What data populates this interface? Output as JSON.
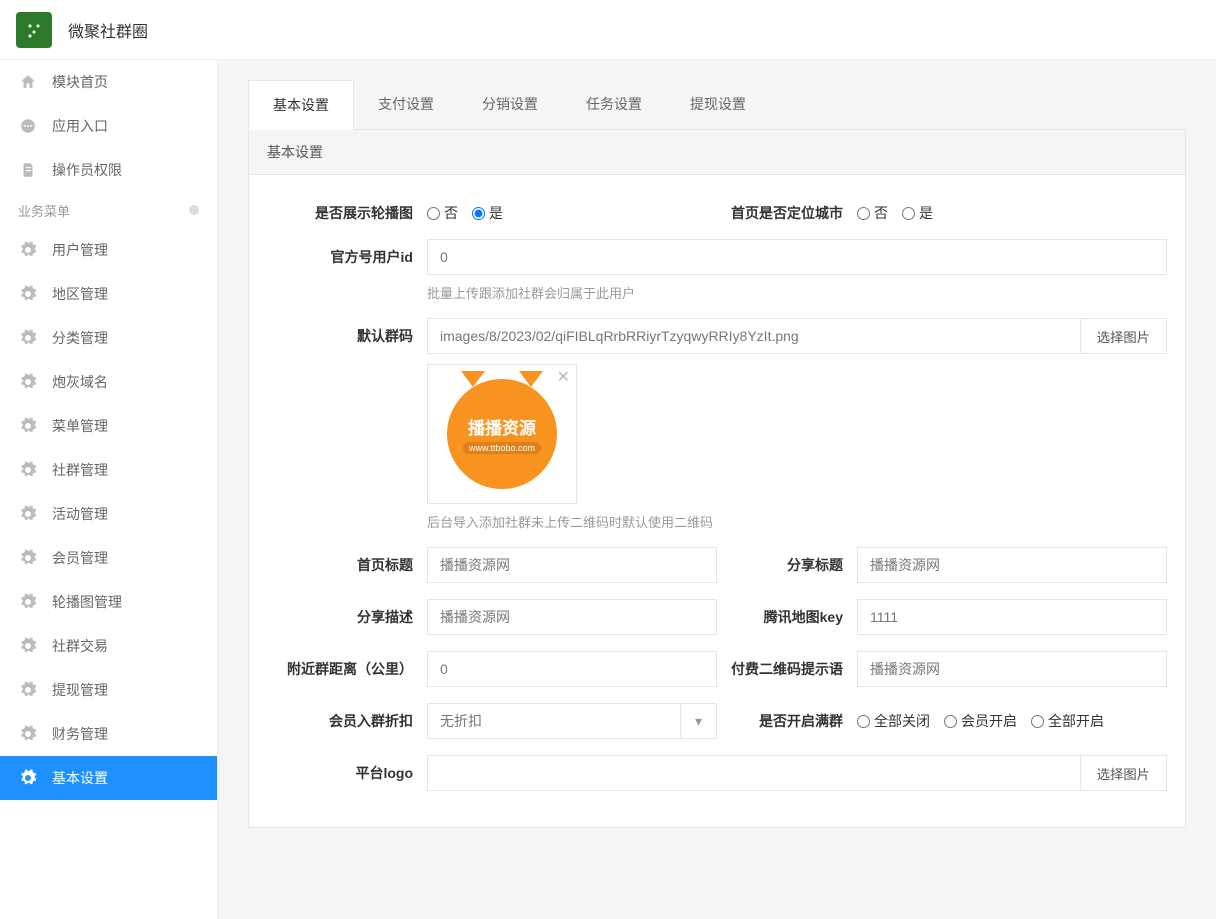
{
  "header": {
    "app_title": "微聚社群圈"
  },
  "sidebar": {
    "top_items": [
      {
        "label": "模块首页",
        "icon": "home"
      },
      {
        "label": "应用入口",
        "icon": "chat"
      },
      {
        "label": "操作员权限",
        "icon": "doc"
      }
    ],
    "section_label": "业务菜单",
    "biz_items": [
      {
        "label": "用户管理"
      },
      {
        "label": "地区管理"
      },
      {
        "label": "分类管理"
      },
      {
        "label": "炮灰域名"
      },
      {
        "label": "菜单管理"
      },
      {
        "label": "社群管理"
      },
      {
        "label": "活动管理"
      },
      {
        "label": "会员管理"
      },
      {
        "label": "轮播图管理"
      },
      {
        "label": "社群交易"
      },
      {
        "label": "提现管理"
      },
      {
        "label": "财务管理"
      },
      {
        "label": "基本设置",
        "active": true
      }
    ]
  },
  "tabs": [
    {
      "label": "基本设置",
      "active": true
    },
    {
      "label": "支付设置"
    },
    {
      "label": "分销设置"
    },
    {
      "label": "任务设置"
    },
    {
      "label": "提现设置"
    }
  ],
  "panel": {
    "title": "基本设置",
    "fields": {
      "carousel_label": "是否展示轮播图",
      "carousel_no": "否",
      "carousel_yes": "是",
      "locate_label": "首页是否定位城市",
      "locate_no": "否",
      "locate_yes": "是",
      "official_id_label": "官方号用户id",
      "official_id_value": "0",
      "official_id_help": "批量上传跟添加社群会归属于此用户",
      "default_qr_label": "默认群码",
      "default_qr_value": "images/8/2023/02/qiFIBLqRrbRRiyrTzyqwyRRIy8YzIt.png",
      "select_image_btn": "选择图片",
      "default_qr_help": "后台导入添加社群未上传二维码时默认使用二维码",
      "preview_title": "播播资源",
      "preview_sub": "www.ttbobo.com",
      "home_title_label": "首页标题",
      "home_title_value": "播播资源网",
      "share_title_label": "分享标题",
      "share_title_value": "播播资源网",
      "share_desc_label": "分享描述",
      "share_desc_value": "播播资源网",
      "map_key_label": "腾讯地图key",
      "map_key_value": "1111",
      "distance_label": "附近群距离（公里）",
      "distance_value": "0",
      "paid_qr_label": "付费二维码提示语",
      "paid_qr_value": "播播资源网",
      "discount_label": "会员入群折扣",
      "discount_value": "无折扣",
      "full_group_label": "是否开启满群",
      "full_group_opt1": "全部关闭",
      "full_group_opt2": "会员开启",
      "full_group_opt3": "全部开启",
      "logo_label": "平台logo",
      "logo_value": ""
    }
  }
}
